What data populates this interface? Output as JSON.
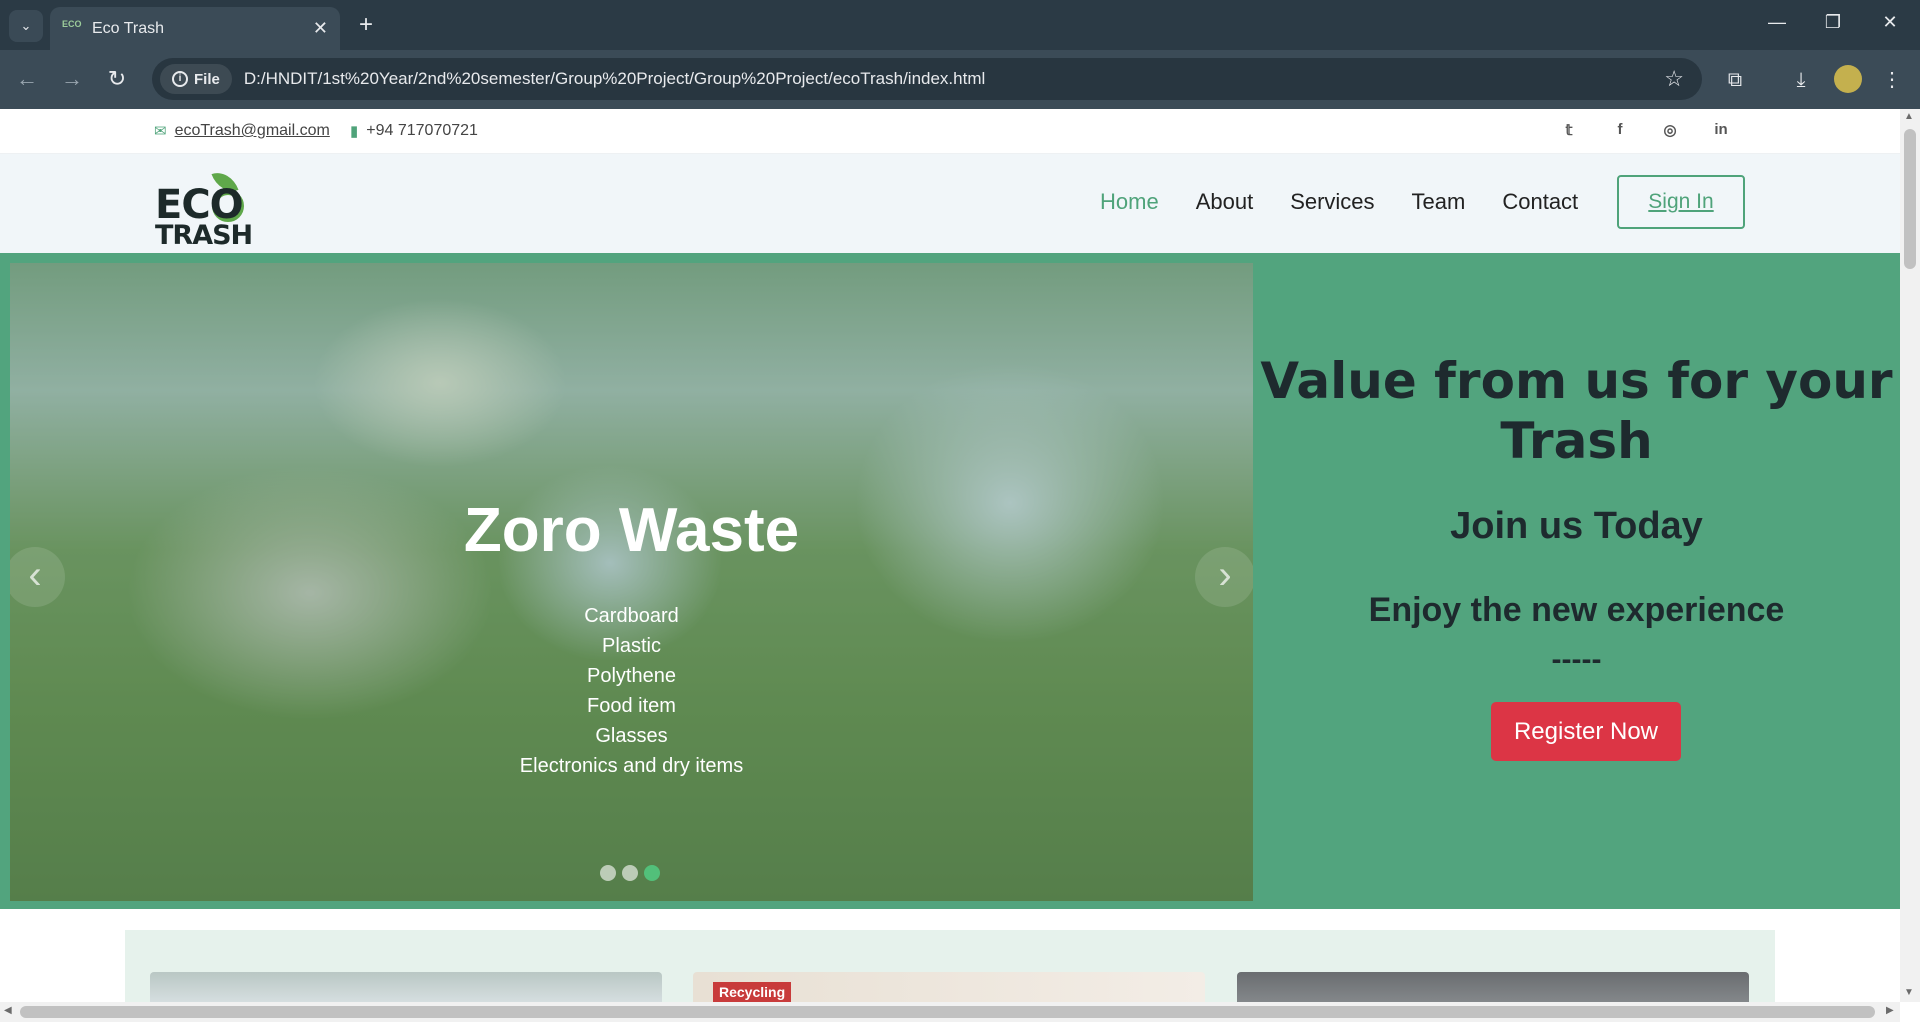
{
  "browser": {
    "tab_title": "Eco Trash",
    "favicon_text": "ECO",
    "url_chip": "File",
    "url": "D:/HNDIT/1st%20Year/2nd%20semester/Group%20Project/Group%20Project/ecoTrash/index.html"
  },
  "topbar": {
    "email": "ecoTrash@gmail.com",
    "phone": "+94 717070721",
    "social": [
      "twitter-icon",
      "facebook-icon",
      "instagram-icon",
      "linkedin-icon"
    ]
  },
  "logo": {
    "line1": "ECO",
    "line2": "TRASH"
  },
  "nav": {
    "links": [
      "Home",
      "About",
      "Services",
      "Team",
      "Contact"
    ],
    "active": "Home",
    "signin": "Sign In"
  },
  "carousel": {
    "headline": "Zoro Waste",
    "items": [
      "Cardboard",
      "Plastic",
      "Polythene",
      "Food item",
      "Glasses",
      "Electronics and dry items"
    ],
    "active_slide": 3,
    "slides": 3
  },
  "hero": {
    "title": "Value from us for your Trash",
    "subtitle": "Join us Today",
    "tagline": "Enjoy the new experience",
    "divider": "-----",
    "cta": "Register Now"
  },
  "services": {
    "card2_tag": "Recycling"
  },
  "colors": {
    "brand_green": "#52a47e",
    "accent_green": "#4fa37a",
    "cta_red": "#dc3545"
  }
}
